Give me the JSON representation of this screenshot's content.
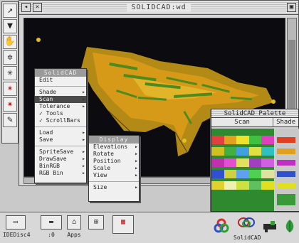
{
  "window": {
    "title": "SOLIDCAD:wd"
  },
  "toolstrip": {
    "tools": [
      {
        "name": "pointer-arrow-icon",
        "glyph": "↗"
      },
      {
        "name": "funnel-tool-icon",
        "glyph": "▼"
      },
      {
        "name": "hand-tool-icon",
        "glyph": "✋"
      },
      {
        "name": "dual-star-tool-icon",
        "glyph": "✲"
      },
      {
        "name": "dual-star-rotate-tool-icon",
        "glyph": "✳"
      },
      {
        "name": "red-star-tool-icon",
        "glyph": "✶"
      },
      {
        "name": "red-star-alt-tool-icon",
        "glyph": "✷"
      },
      {
        "name": "pencil-tool-icon",
        "glyph": "✎"
      }
    ]
  },
  "main_menu": {
    "title": "SolidCAD",
    "items": [
      {
        "label": "Edit",
        "arrow": false
      },
      {
        "label": "Shade",
        "arrow": true
      },
      {
        "label": "Scan",
        "arrow": true,
        "selected": true
      },
      {
        "label": "Tolerance",
        "arrow": true
      },
      {
        "label": "✓ Tools",
        "arrow": false
      },
      {
        "label": "✓ ScrollBars",
        "arrow": false
      },
      {
        "label": "Load",
        "arrow": true
      },
      {
        "label": "Save",
        "arrow": true
      },
      {
        "label": "SpriteSave",
        "arrow": true
      },
      {
        "label": "DrawSave",
        "arrow": true
      },
      {
        "label": "BinRGB",
        "arrow": true
      },
      {
        "label": "RGB Bin",
        "arrow": true
      }
    ]
  },
  "display_menu": {
    "title": "Display",
    "items": [
      {
        "label": "Elevations",
        "arrow": true
      },
      {
        "label": "Rotate",
        "arrow": true
      },
      {
        "label": "Position",
        "arrow": true
      },
      {
        "label": "Scale",
        "arrow": true
      },
      {
        "label": "View",
        "arrow": true
      },
      {
        "label": "Size",
        "arrow": true
      }
    ]
  },
  "palette": {
    "title": "SolidCAD Palette",
    "headers": [
      "Scan",
      "Shade"
    ],
    "colors": {
      "bg_green": "#3a9a3a",
      "accent_yellow": "#e8d020",
      "accent_magenta": "#c030b0",
      "accent_blue": "#3050d0"
    }
  },
  "iconbar": {
    "items": [
      {
        "name": "ide-disc-drive-icon",
        "glyph": "▭",
        "label": "IDEDisc4"
      },
      {
        "name": "floppy-drive-icon",
        "glyph": "▬",
        "label": ":0"
      },
      {
        "name": "apps-folder-icon",
        "glyph": "⌂",
        "label": "Apps"
      },
      {
        "name": "network-icon",
        "glyph": "⊞",
        "label": ""
      },
      {
        "name": "printer-icon",
        "glyph": "▦",
        "label": ""
      }
    ],
    "solidcad_label": "SolidCAD"
  },
  "model": {
    "name": "aircraft-wireframe",
    "colors": [
      "#c7a018",
      "#d48a12",
      "#5a8a20"
    ]
  }
}
